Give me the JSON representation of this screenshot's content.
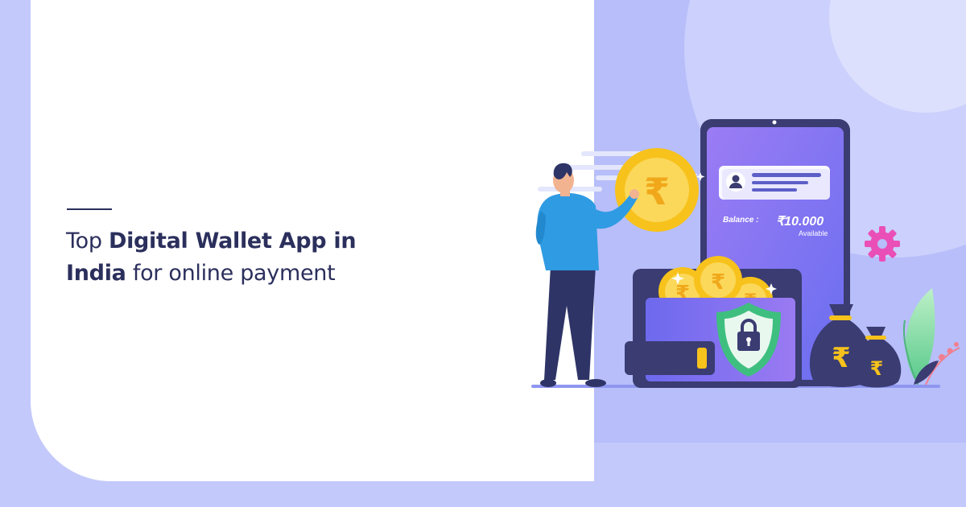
{
  "heading": {
    "part1": "Top ",
    "part2_bold": "Digital Wallet App in",
    "part3_bold": "India",
    "part4": " for online payment"
  },
  "phone": {
    "balance_label": "Balance :",
    "balance_amount": "₹10.000",
    "available_label": "Available"
  },
  "icons": {
    "coin_symbol": "₹",
    "bag_symbol": "₹"
  },
  "colors": {
    "background": "#c3c9fb",
    "panel": "#ffffff",
    "heading_text": "#2b2f5c",
    "coin": "#f7c21b",
    "phone_screen": "#8a73f1",
    "gear": "#e94fb7",
    "shield": "#3fbf7f"
  }
}
